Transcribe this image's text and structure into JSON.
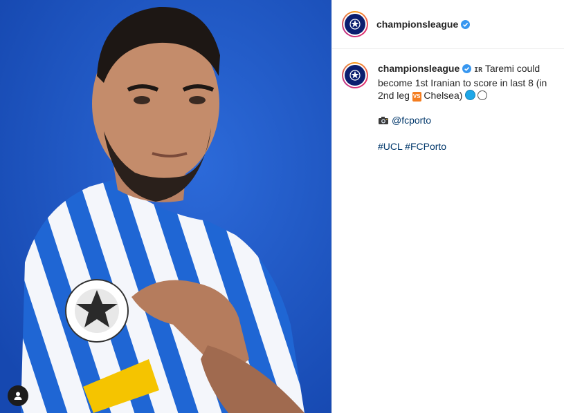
{
  "post": {
    "username": "championsleague",
    "avatar_icon": "uefa-champions-league-starball-logo",
    "verified": true,
    "caption": {
      "flag_label": "IR",
      "line1": "Taremi could become 1st Iranian to score in last 8 (in 2nd leg",
      "vs_label": "VS",
      "line1_end": "Chelsea)",
      "photo_credit": "@fcporto",
      "hashtag1": "#UCL",
      "hashtag2": "#FCPorto"
    }
  },
  "colors": {
    "photo_background": "#1f56c5",
    "verified_badge": "#3897f0",
    "hashtag": "#00376b"
  }
}
